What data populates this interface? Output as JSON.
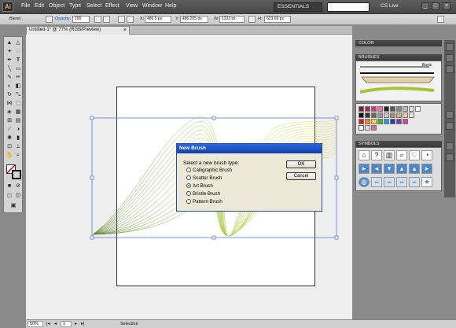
{
  "app": {
    "logo": "Ai"
  },
  "menu": {
    "items": [
      "File",
      "Edit",
      "Object",
      "Type",
      "Select",
      "Effect",
      "View",
      "Window",
      "Help"
    ],
    "workspace": "ESSENTIALS",
    "cslive": "CS Live",
    "window_buttons": [
      "_",
      "□",
      "×"
    ]
  },
  "control_bar": {
    "selection_label": "Blend",
    "opacity_label": "Opacity:",
    "opacity_value": "100",
    "x_label": "X:",
    "x_value": "486.5 px",
    "y_label": "Y:",
    "y_value": "486.205 px",
    "w_label": "W:",
    "w_value": "1233 px",
    "h_label": "H:",
    "h_value": "623.69 px"
  },
  "document": {
    "tab_title": "Untitled-1* @ 77% (RGB/Preview)",
    "tab_close": "×"
  },
  "status": {
    "zoom": "50%",
    "page": "1",
    "mode": "Selection"
  },
  "panels": {
    "color": {
      "title": "COLOR"
    },
    "brushes": {
      "title": "BRUSHES",
      "preset_label": "Basic"
    },
    "symbols": {
      "title": "SYMBOLS"
    }
  },
  "dialog": {
    "title": "New Brush",
    "prompt": "Select a new brush type:",
    "options": [
      {
        "label": "Calligraphic Brush",
        "selected": false
      },
      {
        "label": "Scatter Brush",
        "selected": false
      },
      {
        "label": "Art Brush",
        "selected": true
      },
      {
        "label": "Bristle Brush",
        "selected": false
      },
      {
        "label": "Pattern Brush",
        "selected": false
      }
    ],
    "ok_label": "OK",
    "cancel_label": "Cancel"
  },
  "colors": {
    "accent": "#1641b0",
    "blend_light": "#c8d43a",
    "blend_dark": "#4e7a26"
  }
}
